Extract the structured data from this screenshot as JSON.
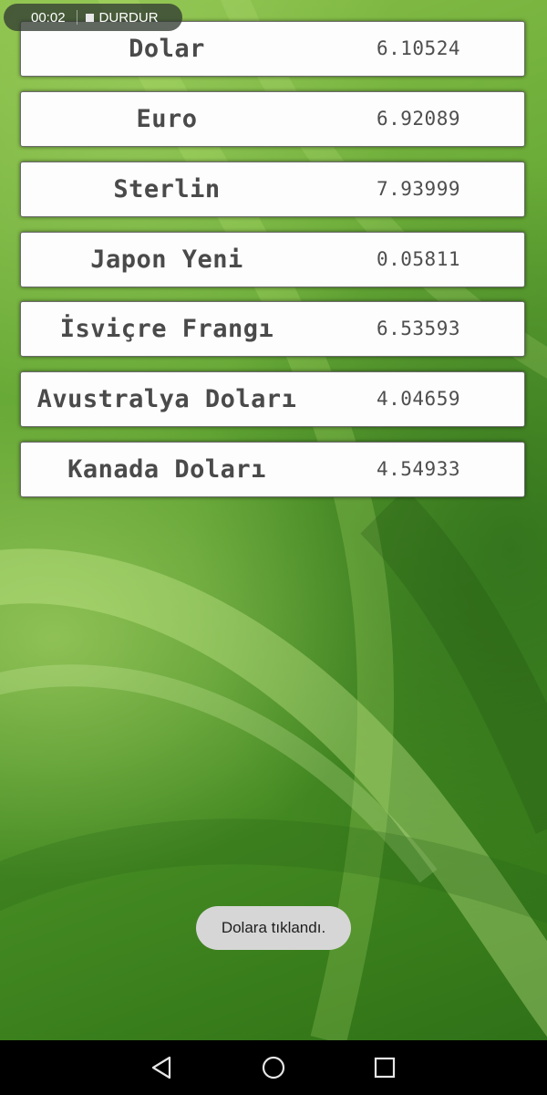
{
  "recording": {
    "time": "00:02",
    "stop_label": "DURDUR"
  },
  "currencies": [
    {
      "name": "Dolar",
      "value": "6.10524"
    },
    {
      "name": "Euro",
      "value": "6.92089"
    },
    {
      "name": "Sterlin",
      "value": "7.93999"
    },
    {
      "name": "Japon Yeni",
      "value": "0.05811"
    },
    {
      "name": "İsviçre Frangı",
      "value": "6.53593"
    },
    {
      "name": "Avustralya Doları",
      "value": "4.04659"
    },
    {
      "name": "Kanada Doları",
      "value": "4.54933"
    }
  ],
  "toast": {
    "message": "Dolara tıklandı."
  },
  "navbar": {
    "back_icon": "back-triangle-icon",
    "home_icon": "home-circle-icon",
    "recents_icon": "recents-square-icon"
  },
  "colors": {
    "background_green": "#4e9428",
    "row_background": "#fdfdfd",
    "toast_background": "#d6d6d6",
    "navbar_background": "#000000"
  }
}
